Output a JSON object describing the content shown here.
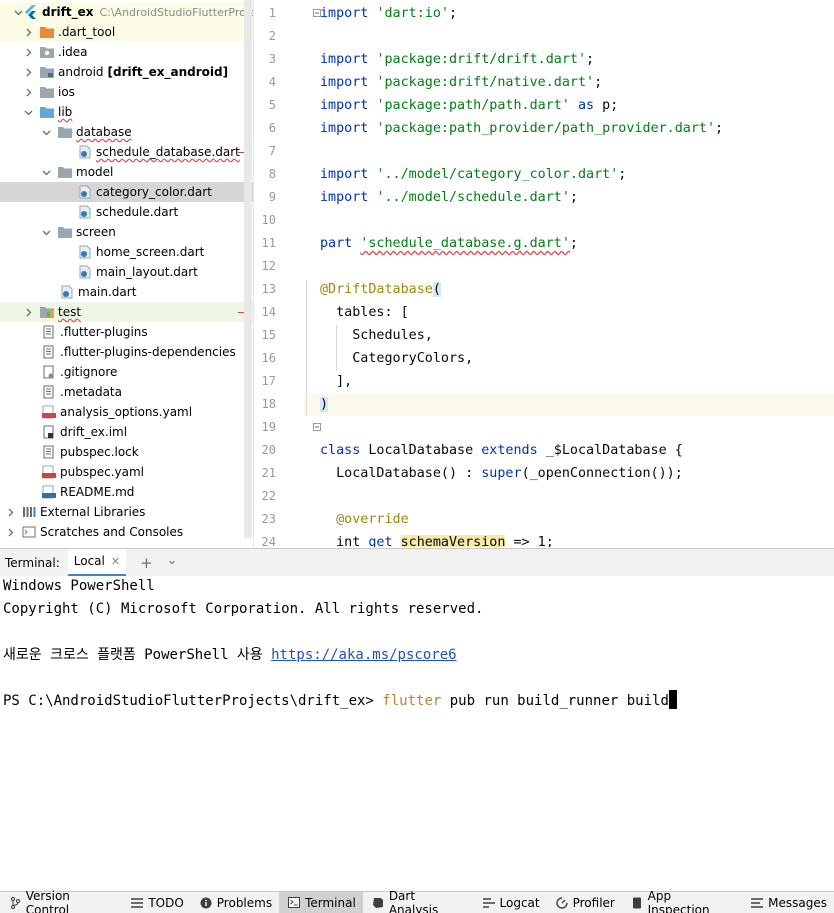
{
  "project": {
    "root_name": "drift_ex",
    "root_path": "C:\\AndroidStudioFlutterProje",
    "items": [
      {
        "label": ".dart_tool"
      },
      {
        "label": ".idea"
      },
      {
        "label": "android",
        "suffix": "[drift_ex_android]"
      },
      {
        "label": "ios"
      },
      {
        "label": "lib"
      },
      {
        "label": "database"
      },
      {
        "label": "schedule_database.dart"
      },
      {
        "label": "model"
      },
      {
        "label": "category_color.dart"
      },
      {
        "label": "schedule.dart"
      },
      {
        "label": "screen"
      },
      {
        "label": "home_screen.dart"
      },
      {
        "label": "main_layout.dart"
      },
      {
        "label": "main.dart"
      },
      {
        "label": "test"
      },
      {
        "label": ".flutter-plugins"
      },
      {
        "label": ".flutter-plugins-dependencies"
      },
      {
        "label": ".gitignore"
      },
      {
        "label": ".metadata"
      },
      {
        "label": "analysis_options.yaml"
      },
      {
        "label": "drift_ex.iml"
      },
      {
        "label": "pubspec.lock"
      },
      {
        "label": "pubspec.yaml"
      },
      {
        "label": "README.md"
      },
      {
        "label": "External Libraries"
      },
      {
        "label": "Scratches and Consoles"
      }
    ]
  },
  "editor": {
    "line_numbers": [
      "1",
      "2",
      "3",
      "4",
      "5",
      "6",
      "7",
      "8",
      "9",
      "10",
      "11",
      "12",
      "13",
      "14",
      "15",
      "16",
      "17",
      "18",
      "19",
      "20",
      "21",
      "22",
      "23",
      "24"
    ],
    "tokens": {
      "import": "import",
      "s_io": "'dart:io'",
      "s_drift": "'package:drift/drift.dart'",
      "s_native": "'package:drift/native.dart'",
      "s_path": "'package:path/path.dart'",
      "as": "as",
      "p": " p;",
      "s_provider": "'package:path_provider/path_provider.dart'",
      "s_catcolor": "'../model/category_color.dart'",
      "s_schedule": "'../model/schedule.dart'",
      "part": "part",
      "s_part": "'schedule_database.g.dart'",
      "annotation": "@DriftDatabase",
      "lparen": "(",
      "tables": "  tables: [",
      "schedules": "    Schedules,",
      "categorycolors": "    CategoryColors,",
      "close_list": "  ],",
      "rparen": ")",
      "class": "class",
      "classname": " LocalDatabase ",
      "extends": "extends",
      "superclass": " _$LocalDatabase {",
      "ctor": "  LocalDatabase() : ",
      "super": "super",
      "ctor_end": "(_openConnection());",
      "override": "@override",
      "int": "  int ",
      "get": "get",
      "schemaVersion": "schemaVersion",
      "sv_end": " => 1;",
      "semicolon": ";"
    }
  },
  "terminal": {
    "title": "Terminal:",
    "tab_label": "Local",
    "close_glyph": "✕",
    "add_glyph": "+",
    "dropdown_glyph": "⌄",
    "lines": {
      "l1": "Windows PowerShell",
      "l2": "Copyright (C) Microsoft Corporation. All rights reserved.",
      "l4_prefix": "새로운 크로스 플랫폼 PowerShell 사용 ",
      "l4_link": "https://aka.ms/pscore6",
      "prompt": "PS C:\\AndroidStudioFlutterProjects\\drift_ex> ",
      "cmd_flutter": "flutter",
      "cmd_rest": " pub run build_runner build"
    }
  },
  "toolbar": {
    "items": [
      {
        "label": "Version Control",
        "icon": "branch-icon"
      },
      {
        "label": "TODO",
        "icon": "list-icon"
      },
      {
        "label": "Problems",
        "icon": "info-icon"
      },
      {
        "label": "Terminal",
        "icon": "terminal-icon"
      },
      {
        "label": "Dart Analysis",
        "icon": "dart-icon"
      },
      {
        "label": "Logcat",
        "icon": "logcat-icon"
      },
      {
        "label": "Profiler",
        "icon": "profiler-icon"
      },
      {
        "label": "App Inspection",
        "icon": "inspection-icon"
      },
      {
        "label": "Messages",
        "icon": "messages-icon"
      }
    ]
  },
  "colors": {
    "keyword": "#0033b3",
    "string": "#067d17",
    "annotation": "#9e880d",
    "selection": "#d5d5d5",
    "active_tab": "#4083c9"
  }
}
